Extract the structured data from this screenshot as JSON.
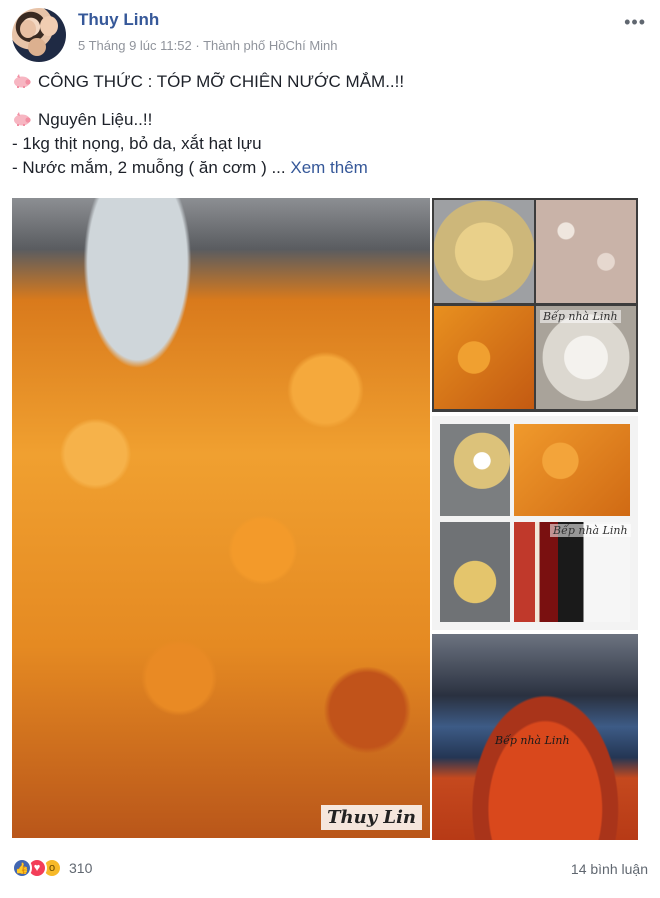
{
  "post": {
    "author": "Thuy Linh",
    "date": "5 Tháng 9 lúc 11:52",
    "separator": "·",
    "location": "Thành phố HồChí Minh",
    "text_lines": [
      "CÔNG THỨC : TÓP MỠ CHIÊN NƯỚC MẮM..!!",
      "Nguyên Liệu..!!",
      "- 1kg thịt nọng, bỏ da, xắt hạt lựu",
      "- Nước mắm, 2 muỗng ( ăn cơm ) ..."
    ],
    "see_more": "Xem thêm"
  },
  "photos": {
    "main_watermark": "Thuy Lin",
    "collage_watermark_1": "Bếp nhà Linh",
    "collage_watermark_2": "Bếp nhà Linh",
    "collage_watermark_3": "Bếp nhà Linh"
  },
  "footer": {
    "reaction_icons": [
      "like-icon",
      "love-icon",
      "wow-icon"
    ],
    "reaction_count": "310",
    "comments": "14 bình luận"
  },
  "colors": {
    "author_link": "#365899",
    "meta_gray": "#90949c",
    "like_blue": "#4267b2",
    "love_red": "#f33e58",
    "wow_yellow": "#f7b928"
  }
}
